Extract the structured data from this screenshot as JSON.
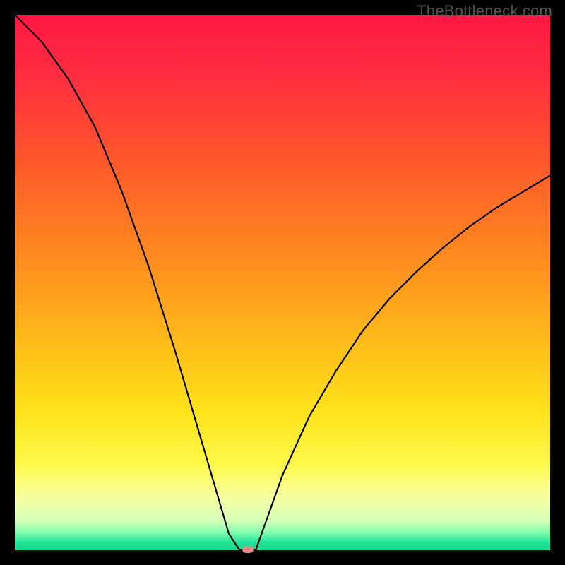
{
  "watermark": "TheBottleneck.com",
  "colors": {
    "curve_stroke": "#000000",
    "marker_fill": "#d98d85",
    "frame_background": "#000000"
  },
  "gradient_stops": [
    {
      "offset": 0.0,
      "color": "#ff1744"
    },
    {
      "offset": 0.12,
      "color": "#ff2f3f"
    },
    {
      "offset": 0.28,
      "color": "#ff5a2a"
    },
    {
      "offset": 0.45,
      "color": "#ff8a1f"
    },
    {
      "offset": 0.6,
      "color": "#ffb81a"
    },
    {
      "offset": 0.74,
      "color": "#ffe21a"
    },
    {
      "offset": 0.84,
      "color": "#fff94a"
    },
    {
      "offset": 0.9,
      "color": "#f7ffa0"
    },
    {
      "offset": 0.945,
      "color": "#d5ffb8"
    },
    {
      "offset": 0.965,
      "color": "#8affb0"
    },
    {
      "offset": 0.985,
      "color": "#20e69a"
    },
    {
      "offset": 1.0,
      "color": "#18d68c"
    }
  ],
  "chart_data": {
    "type": "line",
    "title": "",
    "xlabel": "",
    "ylabel": "",
    "xlim": [
      0,
      100
    ],
    "ylim": [
      0,
      100
    ],
    "optimum_x": 43,
    "marker": {
      "x": 43.5,
      "y": 0
    },
    "left_curve": {
      "x": [
        0,
        5,
        10,
        15,
        20,
        25,
        30,
        35,
        40,
        42
      ],
      "y": [
        100,
        95,
        88,
        79,
        67,
        53,
        37,
        20,
        3,
        0
      ]
    },
    "flat_segment": {
      "x": [
        42,
        45
      ],
      "y": [
        0,
        0
      ]
    },
    "right_curve": {
      "x": [
        45,
        50,
        55,
        60,
        65,
        70,
        75,
        80,
        85,
        90,
        95,
        100
      ],
      "y": [
        0,
        14,
        25,
        33.5,
        41,
        47,
        52,
        56.5,
        60.5,
        64,
        67,
        70
      ]
    }
  }
}
